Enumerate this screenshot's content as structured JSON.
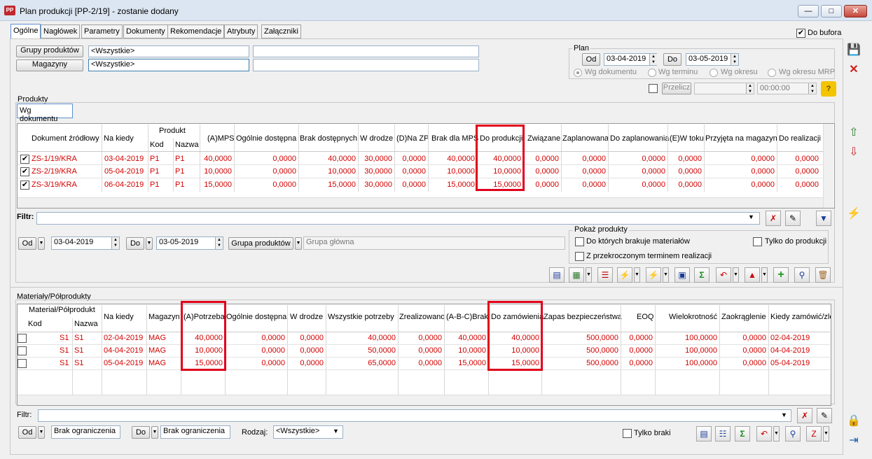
{
  "window": {
    "title": "Plan produkcji [PP-2/19] - zostanie dodany",
    "icon_text": "PP"
  },
  "tabs": [
    "Ogólne",
    "Nagłówek",
    "Parametry",
    "Dokumenty",
    "Rekomendacje",
    "Atrybuty",
    "Załączniki"
  ],
  "do_bufora": "Do bufora",
  "filters_top": {
    "grupy_btn": "Grupy produktów",
    "grupy_value": "<Wszystkie>",
    "magazyny_btn": "Magazyny",
    "magazyny_value": "<Wszystkie>"
  },
  "plan": {
    "label": "Plan",
    "od_label": "Od",
    "od_value": "03-04-2019",
    "do_label": "Do",
    "do_value": "03-05-2019",
    "radios": [
      "Wg dokumentu",
      "Wg terminu",
      "Wg okresu",
      "Wg okresu MRP"
    ],
    "przelicz": "Przelicz",
    "time": "00:00:00"
  },
  "produkty": {
    "label": "Produkty",
    "subtab": "Wg dokumentu",
    "headers": {
      "doc": "Dokument źródłowy",
      "na_kiedy": "Na kiedy",
      "produkt": "Produkt",
      "kod": "Kod",
      "nazwa": "Nazwa",
      "mps": "(A)MPS",
      "ogolnie": "Ogólnie dostępna",
      "brak": "Brak dostępnych",
      "wdrodze": "W drodze",
      "nazp": "(D)Na ZP",
      "brakmps": "Brak dla MPS",
      "doprod": "Do produkcji",
      "zwiazane": "Związane",
      "zaplanowana": "Zaplanowana",
      "dozaplan": "Do zaplanowania",
      "wtoku": "(E)W toku",
      "przyjeta": "Przyjęta na magazyn",
      "dorealizacji": "Do realizacji"
    },
    "rows": [
      {
        "checked": "✔",
        "doc": "ZS-1/19/KRA",
        "na_kiedy": "03-04-2019",
        "kod": "P1",
        "nazwa": "P1",
        "mps": "40,0000",
        "ogolnie": "0,0000",
        "brak": "40,0000",
        "wdrodze": "30,0000",
        "nazp": "0,0000",
        "brakmps": "40,0000",
        "doprod": "40,0000",
        "zwiazane": "0,0000",
        "zaplanowana": "0,0000",
        "dozaplan": "0,0000",
        "wtoku": "0,0000",
        "przyjeta": "0,0000",
        "dorealizacji": "0,0000"
      },
      {
        "checked": "✔",
        "doc": "ZS-2/19/KRA",
        "na_kiedy": "05-04-2019",
        "kod": "P1",
        "nazwa": "P1",
        "mps": "10,0000",
        "ogolnie": "0,0000",
        "brak": "10,0000",
        "wdrodze": "30,0000",
        "nazp": "0,0000",
        "brakmps": "10,0000",
        "doprod": "10,0000",
        "zwiazane": "0,0000",
        "zaplanowana": "0,0000",
        "dozaplan": "0,0000",
        "wtoku": "0,0000",
        "przyjeta": "0,0000",
        "dorealizacji": "0,0000"
      },
      {
        "checked": "✔",
        "doc": "ZS-3/19/KRA",
        "na_kiedy": "06-04-2019",
        "kod": "P1",
        "nazwa": "P1",
        "mps": "15,0000",
        "ogolnie": "0,0000",
        "brak": "15,0000",
        "wdrodze": "30,0000",
        "nazp": "0,0000",
        "brakmps": "15,0000",
        "doprod": "15,0000",
        "zwiazane": "0,0000",
        "zaplanowana": "0,0000",
        "dozaplan": "0,0000",
        "wtoku": "0,0000",
        "przyjeta": "0,0000",
        "dorealizacji": "0,0000"
      }
    ],
    "filtr_label": "Filtr:",
    "od_label": "Od",
    "od_value": "03-04-2019",
    "do_label": "Do",
    "do_value": "03-05-2019",
    "grupa_btn": "Grupa produktów",
    "grupa_value": "Grupa główna",
    "pokaz": {
      "label": "Pokaż produkty",
      "opt1": "Do których brakuje materiałów",
      "opt2": "Z przekroczonym terminem realizacji",
      "opt3": "Tylko do produkcji"
    }
  },
  "materialy": {
    "label": "Materiały/Półprodukty",
    "headers": {
      "matpol": "Materiał/Półprodukt",
      "kod": "Kod",
      "nazwa": "Nazwa",
      "na_kiedy": "Na kiedy",
      "magazyn": "Magazyn",
      "potrzeba": "(A)Potrzeba",
      "ogolnie": "Ogólnie dostępna",
      "wdrodze": "W drodze",
      "wszystkie": "Wszystkie potrzeby",
      "zrealizowano": "Zrealizowano",
      "abc": "(A-B-C)Brak",
      "dozam": "Do zamówienia",
      "zapas": "Zapas bezpieczeństwa",
      "eoq": "EOQ",
      "wielokrotnosc": "Wielokrotność",
      "zaokraglenie": "Zaokrąglenie",
      "kiedy": "Kiedy zamówić/zle"
    },
    "rows": [
      {
        "kod": "S1",
        "nazwa": "S1",
        "na_kiedy": "02-04-2019",
        "magazyn": "MAG",
        "potrzeba": "40,0000",
        "ogolnie": "0,0000",
        "wdrodze": "0,0000",
        "wszystkie": "40,0000",
        "zrealizowano": "0,0000",
        "abc": "40,0000",
        "dozam": "40,0000",
        "zapas": "500,0000",
        "eoq": "0,0000",
        "wielokrotnosc": "100,0000",
        "zaokraglenie": "0,0000",
        "kiedy": "02-04-2019"
      },
      {
        "kod": "S1",
        "nazwa": "S1",
        "na_kiedy": "04-04-2019",
        "magazyn": "MAG",
        "potrzeba": "10,0000",
        "ogolnie": "0,0000",
        "wdrodze": "0,0000",
        "wszystkie": "50,0000",
        "zrealizowano": "0,0000",
        "abc": "10,0000",
        "dozam": "10,0000",
        "zapas": "500,0000",
        "eoq": "0,0000",
        "wielokrotnosc": "100,0000",
        "zaokraglenie": "0,0000",
        "kiedy": "04-04-2019"
      },
      {
        "kod": "S1",
        "nazwa": "S1",
        "na_kiedy": "05-04-2019",
        "magazyn": "MAG",
        "potrzeba": "15,0000",
        "ogolnie": "0,0000",
        "wdrodze": "0,0000",
        "wszystkie": "65,0000",
        "zrealizowano": "0,0000",
        "abc": "15,0000",
        "dozam": "15,0000",
        "zapas": "500,0000",
        "eoq": "0,0000",
        "wielokrotnosc": "100,0000",
        "zaokraglenie": "0,0000",
        "kiedy": "05-04-2019"
      }
    ],
    "filtr_label": "Filtr:",
    "od_label": "Od",
    "od_value": "Brak ograniczenia",
    "do_label": "Do",
    "do_value": "Brak ograniczenia",
    "rodzaj_label": "Rodzaj:",
    "rodzaj_value": "<Wszystkie>",
    "tylko_braki": "Tylko braki"
  },
  "colors": {
    "data_text": "#d40000",
    "highlight_box": "#e0001a"
  }
}
